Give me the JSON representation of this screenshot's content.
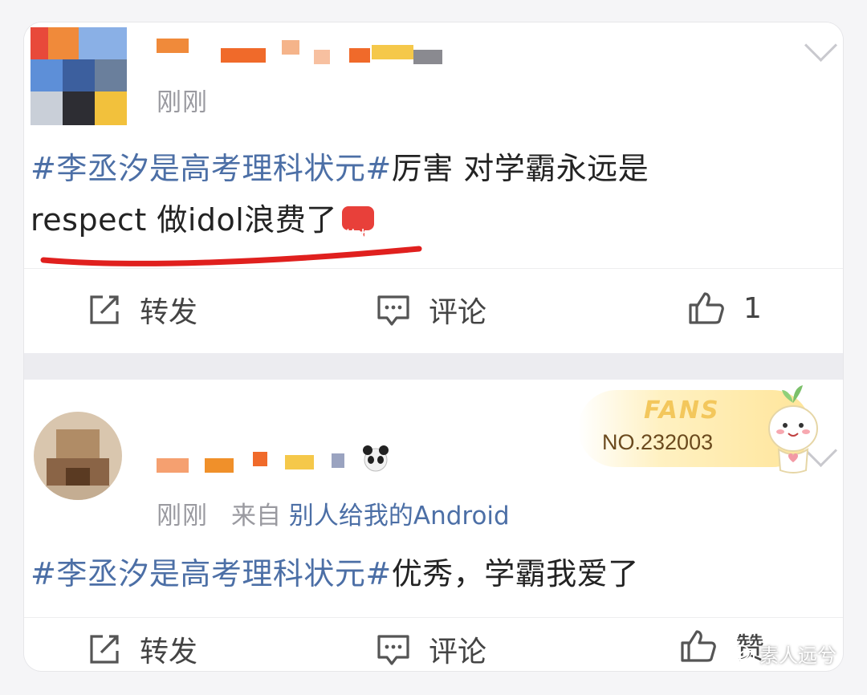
{
  "posts": [
    {
      "time": "刚刚",
      "source_prefix": "",
      "source_app": "",
      "hashtag": "#李丞汐是高考理科状元#",
      "text_line1": "厉害 对学霸永远是",
      "text_line2": "respect 做idol浪费了",
      "emoji_label": "给力",
      "actions": {
        "repost": "转发",
        "comment": "评论",
        "like": "1"
      }
    },
    {
      "time": "刚刚",
      "source_prefix": "来自",
      "source_app": "别人给我的Android",
      "hashtag": "#李丞汐是高考理科状元#",
      "text_line1": "优秀，学霸我爱了",
      "actions": {
        "repost": "转发",
        "comment": "评论",
        "like": "赞"
      },
      "fan_badge": {
        "label": "FANS",
        "number": "NO.232003"
      }
    }
  ],
  "watermark": "素人远兮",
  "colors": {
    "hashtag": "#4c6fa6",
    "underline": "#e0201e",
    "badge_gold": "#ffe59a"
  }
}
